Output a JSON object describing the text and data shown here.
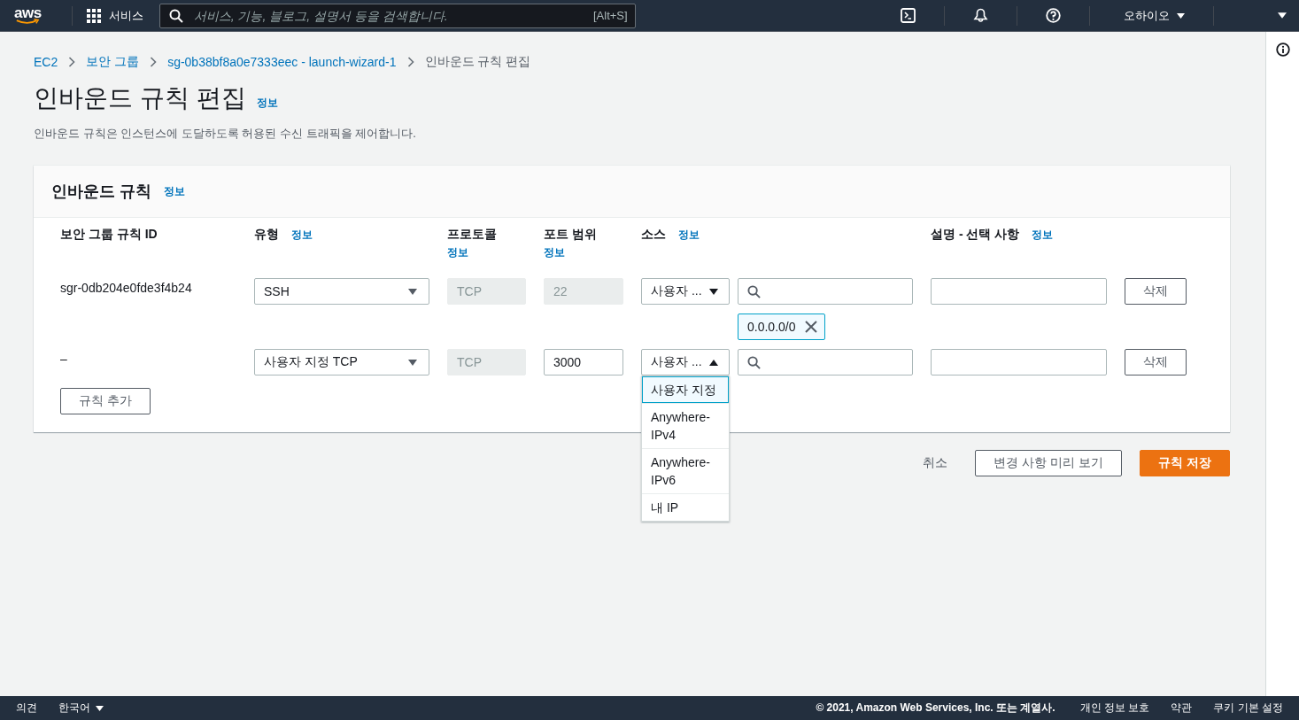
{
  "top_nav": {
    "logo": "aws",
    "services": "서비스",
    "search": {
      "placeholder": "서비스, 기능, 블로그, 설명서 등을 검색합니다.",
      "shortcut": "[Alt+S]"
    },
    "region": "오하이오"
  },
  "breadcrumbs": [
    {
      "label": "EC2",
      "link": true
    },
    {
      "label": "보안 그룹",
      "link": true
    },
    {
      "label": "sg-0b38bf8a0e7333eec - launch-wizard-1",
      "link": true
    },
    {
      "label": "인바운드 규칙 편집",
      "link": false
    }
  ],
  "page": {
    "title": "인바운드 규칙 편집",
    "info": "정보",
    "description": "인바운드 규칙은 인스턴스에 도달하도록 허용된 수신 트래픽을 제어합니다."
  },
  "panel": {
    "title": "인바운드 규칙",
    "info": "정보",
    "columns": [
      {
        "label": "보안 그룹 규칙 ID"
      },
      {
        "label": "유형",
        "info": "정보"
      },
      {
        "label": "프로토콜",
        "info": "정보"
      },
      {
        "label": "포트 범위",
        "info": "정보"
      },
      {
        "label": "소스",
        "info": "정보"
      },
      {
        "label": "설명 - 선택 사항",
        "info": "정보"
      }
    ],
    "rules": [
      {
        "id": "sgr-0db204e0fde3f4b24",
        "type": "SSH",
        "protocol": "TCP",
        "port": "22",
        "port_disabled": true,
        "source": "사용자 ...",
        "source_open": false,
        "cidrs": [
          "0.0.0.0/0"
        ],
        "delete": "삭제"
      },
      {
        "id": "–",
        "type": "사용자 지정 TCP",
        "protocol": "TCP",
        "port": "3000",
        "port_disabled": false,
        "source": "사용자 ...",
        "source_open": true,
        "options": [
          {
            "label": "사용자 지정",
            "selected": true
          },
          {
            "label": "Anywhere-IPv4",
            "selected": false
          },
          {
            "label": "Anywhere-IPv6",
            "selected": false
          },
          {
            "label": "내 IP",
            "selected": false
          }
        ],
        "delete": "삭제"
      }
    ],
    "add_rule": "규칙 추가"
  },
  "actions": {
    "cancel": "취소",
    "preview": "변경 사항 미리 보기",
    "save": "규칙 저장"
  },
  "footer": {
    "feedback": "의견",
    "language": "한국어",
    "copyright": "© 2021, Amazon Web Services, Inc. 또는 계열사.",
    "links": [
      "개인 정보 보호",
      "약관",
      "쿠키 기본 설정"
    ]
  }
}
